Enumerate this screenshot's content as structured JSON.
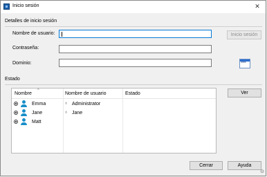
{
  "window": {
    "title": "Inicio sesión"
  },
  "login_group": {
    "label": "Detalles de inicio sesión",
    "username_label": "Nombre de usuario:",
    "username_value": "",
    "password_label": "Contraseña:",
    "password_value": "",
    "domain_label": "Dominio:",
    "domain_value": "",
    "login_button": "Inicio sesión"
  },
  "icons": {
    "password_field_icon": "****"
  },
  "status_group": {
    "label": "Estado",
    "view_button": "Ver",
    "columns": [
      "Nombre",
      "Nombre de usuario",
      "Estado"
    ],
    "rows": [
      {
        "name": "Emma",
        "username": "Administrator",
        "status": ""
      },
      {
        "name": "Jane",
        "username": "Jane",
        "status": ""
      },
      {
        "name": "Matt",
        "username": "",
        "status": ""
      }
    ]
  },
  "footer": {
    "close_button": "Cerrar",
    "help_button": "Ayuda"
  },
  "colors": {
    "accent": "#0078d7",
    "user_icon": "#1a8fc9"
  }
}
